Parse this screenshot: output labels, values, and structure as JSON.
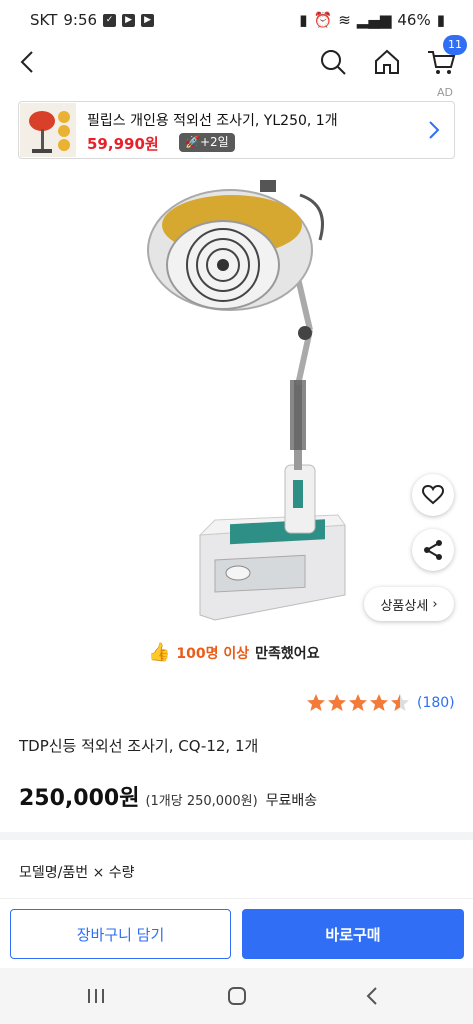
{
  "status": {
    "carrier": "SKT",
    "time": "9:56",
    "battery": "46%"
  },
  "nav": {
    "cart_count": "11"
  },
  "ad": {
    "label": "AD",
    "title": "필립스 개인용 적외선 조사기, YL250, 1개",
    "price": "59,990원",
    "shipping_badge": "+2일"
  },
  "actions": {
    "detail_label": "상품상세"
  },
  "satisfaction": {
    "highlight": "100명 이상",
    "rest": "만족했어요"
  },
  "rating": {
    "stars": 4.5,
    "count": "(180)"
  },
  "product": {
    "title": "TDP신등 적외선 조사기, CQ-12, 1개",
    "price": "250,000원",
    "unit_price": "(1개당 250,000원)",
    "shipping": "무료배송"
  },
  "options": {
    "label": "모델명/품번 × 수량"
  },
  "buttons": {
    "cart": "장바구니 담기",
    "buy": "바로구매"
  },
  "colors": {
    "accent": "#2f6ef5",
    "price_red": "#e8202b",
    "star": "#f27b3a"
  }
}
